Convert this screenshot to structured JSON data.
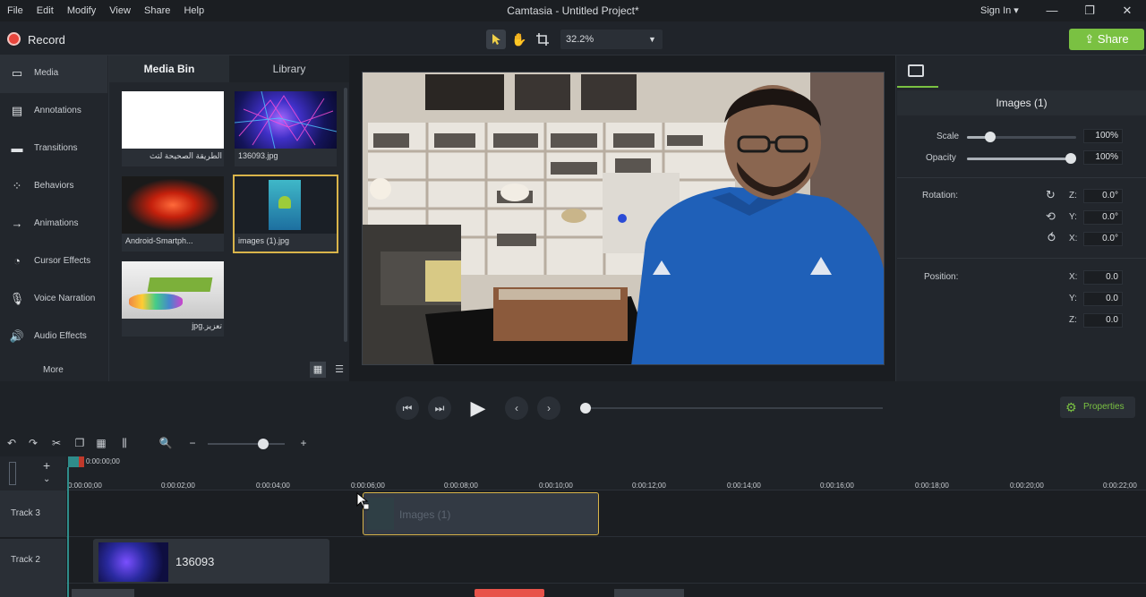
{
  "menu": [
    "File",
    "Edit",
    "Modify",
    "View",
    "Share",
    "Help"
  ],
  "window": {
    "title": "Camtasia - Untitled Project*",
    "sign_in": "Sign In ▾",
    "minimize": "—",
    "maximize": "❐",
    "close": "✕"
  },
  "toolbar": {
    "record_label": "Record",
    "zoom_value": "32.2%",
    "share_label": "Share"
  },
  "sidebar": {
    "items": [
      {
        "label": "Media",
        "icon": "media-icon"
      },
      {
        "label": "Annotations",
        "icon": "annotations-icon"
      },
      {
        "label": "Transitions",
        "icon": "transitions-icon"
      },
      {
        "label": "Behaviors",
        "icon": "behaviors-icon"
      },
      {
        "label": "Animations",
        "icon": "animations-icon"
      },
      {
        "label": "Cursor Effects",
        "icon": "cursor-effects-icon"
      },
      {
        "label": "Voice Narration",
        "icon": "microphone-icon"
      },
      {
        "label": "Audio Effects",
        "icon": "speaker-icon"
      }
    ],
    "more_label": "More"
  },
  "media_bin": {
    "tab_media": "Media Bin",
    "tab_library": "Library",
    "items": [
      {
        "caption": "الطريقة الصحيحة لتث"
      },
      {
        "caption": "136093.jpg"
      },
      {
        "caption": "Android-Smartph..."
      },
      {
        "caption": "images (1).jpg"
      },
      {
        "caption": "تعزيز.jpg"
      }
    ]
  },
  "properties": {
    "header": "Images (1)",
    "scale_label": "Scale",
    "scale_value": "100%",
    "opacity_label": "Opacity",
    "opacity_value": "100%",
    "rotation_label": "Rotation:",
    "rotation": {
      "z": "0.0°",
      "y": "0.0°",
      "x": "0.0°"
    },
    "position_label": "Position:",
    "position": {
      "x": "0.0",
      "y": "0.0",
      "z": "0.0"
    },
    "axis_z": "Z:",
    "axis_y": "Y:",
    "axis_x": "X:",
    "properties_button": "Properties"
  },
  "timeline": {
    "playhead_time": "0:00:00;00",
    "ticks": [
      "0:00:00;00",
      "0:00:02;00",
      "0:00:04;00",
      "0:00:06;00",
      "0:00:08;00",
      "0:00:10;00",
      "0:00:12;00",
      "0:00:14;00",
      "0:00:16;00",
      "0:00:18;00",
      "0:00:20;00",
      "0:00:22;00"
    ],
    "tracks": [
      {
        "name": "Track 3"
      },
      {
        "name": "Track 2"
      }
    ],
    "clip_images_label": "Images (1)",
    "clip_136_label": "136093"
  },
  "colors": {
    "accent_green": "#7ac142",
    "record_red": "#e8453c",
    "selection_gold": "#d9b44a",
    "scroll_red": "#e8534a"
  }
}
